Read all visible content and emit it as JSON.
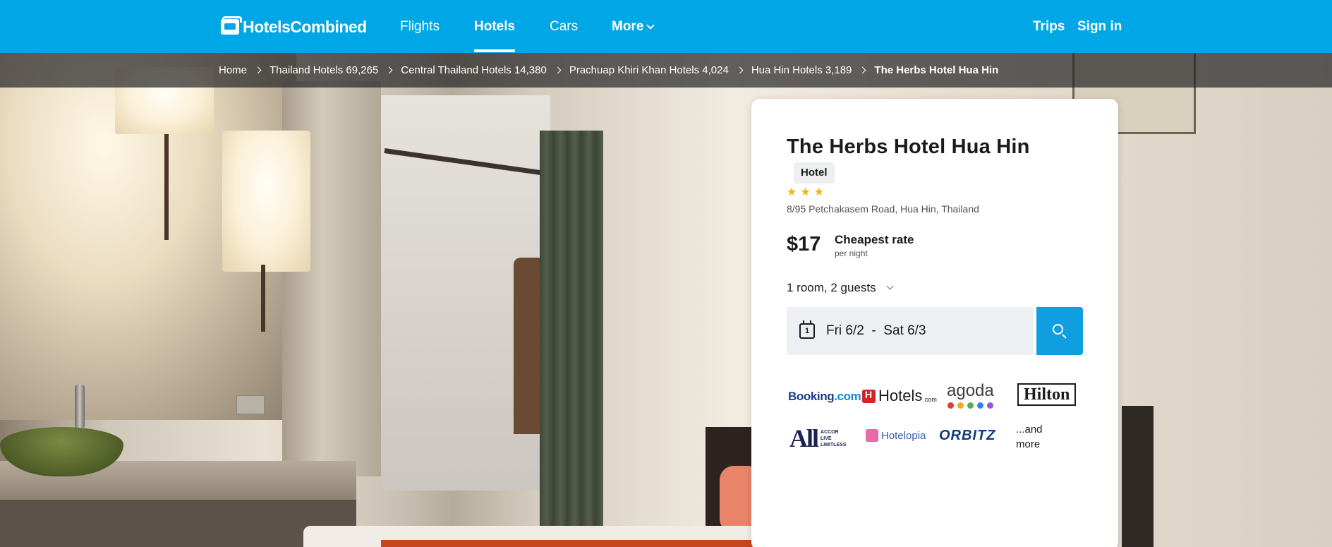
{
  "nav": {
    "logo_text": "HotelsCombined",
    "items": [
      "Flights",
      "Hotels",
      "Cars",
      "More"
    ],
    "active": "Hotels",
    "trips": "Trips",
    "sign_in": "Sign in"
  },
  "breadcrumb": [
    "Home",
    "Thailand Hotels 69,265",
    "Central Thailand Hotels 14,380",
    "Prachuap Khiri Khan Hotels 4,024",
    "Hua Hin Hotels 3,189",
    "The Herbs Hotel Hua Hin"
  ],
  "hotel": {
    "name": "The Herbs Hotel Hua Hin",
    "type": "Hotel",
    "stars": 3,
    "star_glyphs": "★★★",
    "address": "8/95 Petchakasem Road, Hua Hin, Thailand",
    "price": "$17",
    "rate_label": "Cheapest rate",
    "per_night": "per night"
  },
  "search": {
    "guests": "1 room, 2 guests",
    "calendar_day": "1",
    "dates": "Fri 6/2  -  Sat 6/3"
  },
  "partners": {
    "booking_main": "Booking",
    "booking_suffix": ".com",
    "hotels_main": "Hotels",
    "hotels_suffix": ".com",
    "agoda": "agoda",
    "hilton": "Hilton",
    "all_big": "All",
    "all_tagline": [
      "ACCOR",
      "LIVE",
      "LIMITLESS"
    ],
    "hotelopia": "Hotelopia",
    "orbitz": "ORBITZ",
    "more": "...and more"
  },
  "colors": {
    "nav_bg": "#00a7e6",
    "search_button": "#0f9fe0",
    "star": "#f5b400",
    "agoda_dots": [
      "#e23a3a",
      "#f5a623",
      "#4caf50",
      "#2f80ed",
      "#9b51e0"
    ]
  }
}
